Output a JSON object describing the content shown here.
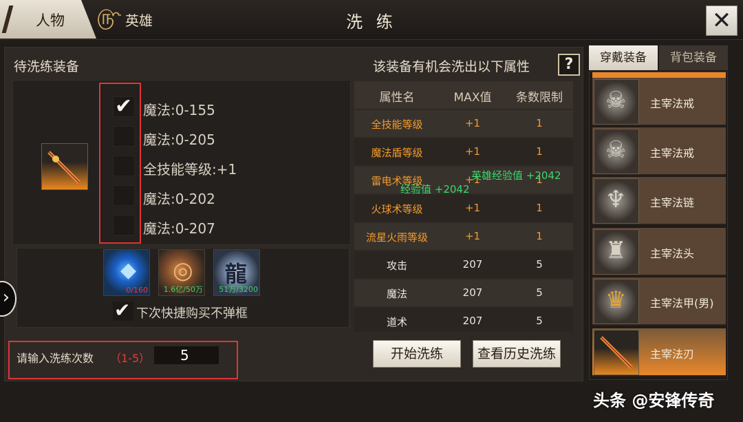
{
  "header": {
    "tabs": [
      {
        "label": "人物",
        "icon": "sword-icon"
      },
      {
        "label": "英雄",
        "icon": "swirl-emblem-icon"
      }
    ],
    "title": "洗 练",
    "close_icon": "close-icon"
  },
  "left_panel": {
    "title": "待洗练装备",
    "equipped_item_icon": "flame-sword-icon",
    "options": [
      {
        "label": "魔法:0-155",
        "checked": true
      },
      {
        "label": "魔法:0-205",
        "checked": false
      },
      {
        "label": "全技能等级:+1",
        "checked": false
      },
      {
        "label": "魔法:0-202",
        "checked": false
      },
      {
        "label": "魔法:0-207",
        "checked": false
      }
    ],
    "materials": [
      {
        "icon": "blue-crystal-icon",
        "count": "0/160",
        "count_color": "#e13b3b"
      },
      {
        "icon": "copper-coin-icon",
        "count": "1.6亿/50万",
        "count_color": "#3fd06a"
      },
      {
        "icon": "dragon-medal-icon",
        "count": "51万/3200",
        "count_color": "#3fd06a"
      }
    ],
    "quick_buy_label": "下次快捷购买不弹框",
    "quick_buy_checked": true,
    "count_label": "请输入洗练次数",
    "count_range": "（1-5）",
    "count_value": "5"
  },
  "attributes": {
    "title": "该装备有机会洗出以下属性",
    "help_label": "?",
    "headers": [
      "属性名",
      "MAX值",
      "条数限制"
    ],
    "rows": [
      {
        "name": "全技能等级",
        "max": "+1",
        "limit": "1",
        "color": "orange"
      },
      {
        "name": "魔法盾等级",
        "max": "+1",
        "limit": "1",
        "color": "orange"
      },
      {
        "name": "雷电术等级",
        "max": "+1",
        "limit": "1",
        "color": "orange"
      },
      {
        "name": "火球术等级",
        "max": "+1",
        "limit": "1",
        "color": "orange"
      },
      {
        "name": "流星火雨等级",
        "max": "+1",
        "limit": "1",
        "color": "orange"
      },
      {
        "name": "攻击",
        "max": "207",
        "limit": "5",
        "color": "white"
      },
      {
        "name": "魔法",
        "max": "207",
        "limit": "5",
        "color": "white"
      },
      {
        "name": "道术",
        "max": "207",
        "limit": "5",
        "color": "white"
      }
    ],
    "floating_texts": [
      "英雄经验值 +2042",
      "经验值 +2042"
    ]
  },
  "buttons": {
    "start": "开始洗练",
    "history": "查看历史洗练"
  },
  "side_panel": {
    "tabs": [
      "穿戴装备",
      "背包装备"
    ],
    "items": [
      {
        "name": "主宰法戒",
        "icon": "skull-ring-icon",
        "selected": false
      },
      {
        "name": "主宰法戒",
        "icon": "skull-ring-icon",
        "selected": false
      },
      {
        "name": "主宰法链",
        "icon": "demon-necklace-icon",
        "selected": false
      },
      {
        "name": "主宰法头",
        "icon": "horned-helmet-icon",
        "selected": false
      },
      {
        "name": "主宰法甲(男)",
        "icon": "golden-armor-icon",
        "selected": false
      },
      {
        "name": "主宰法刃",
        "icon": "flame-sword-icon",
        "selected": true
      }
    ]
  },
  "watermark": "头条 @安锋传奇",
  "colors": {
    "accent_orange": "#e8872a",
    "highlight_red": "#e0353a",
    "gain_green": "#39d86e"
  }
}
